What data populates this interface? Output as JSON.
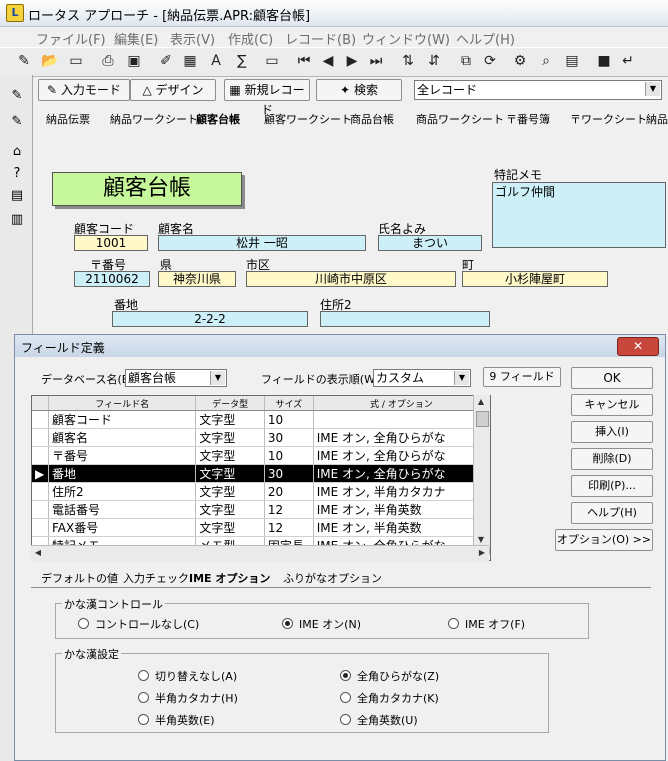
{
  "window": {
    "title": "ロータス アプローチ - [納品伝票.APR:顧客台帳]"
  },
  "menu": [
    "ファイル(F)",
    "編集(E)",
    "表示(V)",
    "作成(C)",
    "レコード(B)",
    "ウィンドウ(W)",
    "ヘルプ(H)"
  ],
  "navbar": {
    "input_mode": "入力モード",
    "design": "デザイン",
    "new_record": "新規レコード",
    "search": "検索",
    "record_filter": "全レコード"
  },
  "tabs": [
    "納品伝票",
    "納品ワークシート",
    "顧客台帳",
    "顧客ワークシート",
    "商品台帳",
    "商品ワークシート",
    "〒番号簿",
    "〒ワークシート",
    "納品"
  ],
  "form": {
    "title": "顧客台帳",
    "memo_label": "特記メモ",
    "memo_value": "ゴルフ仲間",
    "code_label": "顧客コード",
    "code_value": "1001",
    "name_label": "顧客名",
    "name_value": "松井 一昭",
    "yomi_label": "氏名よみ",
    "yomi_value": "まつい",
    "zip_label": "〒番号",
    "zip_value": "2110062",
    "pref_label": "県",
    "pref_value": "神奈川県",
    "city_label": "市区",
    "city_value": "川崎市中原区",
    "town_label": "町",
    "town_value": "小杉陣屋町",
    "banchi_label": "番地",
    "banchi_value": "2-2-2",
    "addr2_label": "住所2",
    "addr2_value": ""
  },
  "dialog": {
    "title": "フィールド定義",
    "db_label": "データベース名(B):",
    "db_value": "顧客台帳",
    "order_label": "フィールドの表示順(W):",
    "order_value": "カスタム",
    "field_count": "9 フィールド",
    "columns": [
      "フィールド名",
      "データ型",
      "サイズ",
      "式 / オプション"
    ],
    "rows": [
      [
        "顧客コード",
        "文字型",
        "10",
        ""
      ],
      [
        "顧客名",
        "文字型",
        "30",
        "IME オン, 全角ひらがな"
      ],
      [
        "〒番号",
        "文字型",
        "10",
        "IME オン, 全角ひらがな"
      ],
      [
        "番地",
        "文字型",
        "30",
        "IME オン, 全角ひらがな"
      ],
      [
        "住所2",
        "文字型",
        "20",
        "IME オン, 半角カタカナ"
      ],
      [
        "電話番号",
        "文字型",
        "12",
        "IME オン, 半角英数"
      ],
      [
        "FAX番号",
        "文字型",
        "12",
        "IME オン, 半角英数"
      ],
      [
        "特記メモ",
        "メモ型",
        "固定長",
        "IME オン, 全角ひらがな"
      ]
    ],
    "buttons": {
      "ok": "OK",
      "cancel": "キャンセル",
      "insert": "挿入(I)",
      "delete": "削除(D)",
      "print": "印刷(P)...",
      "help": "ヘルプ(H)",
      "options": "オプション(O) >>"
    },
    "subtabs": [
      "デフォルトの値",
      "入力チェック",
      "IME オプション",
      "ふりがなオプション"
    ],
    "kana_control": {
      "label": "かな漢コントロール",
      "options": [
        "コントロールなし(C)",
        "IME オン(N)",
        "IME オフ(F)"
      ],
      "selected": 1
    },
    "kana_setting": {
      "label": "かな漢設定",
      "options": [
        "切り替えなし(A)",
        "全角ひらがな(Z)",
        "半角カタカナ(H)",
        "全角カタカナ(K)",
        "半角英数(E)",
        "全角英数(U)"
      ],
      "selected": 1
    }
  }
}
